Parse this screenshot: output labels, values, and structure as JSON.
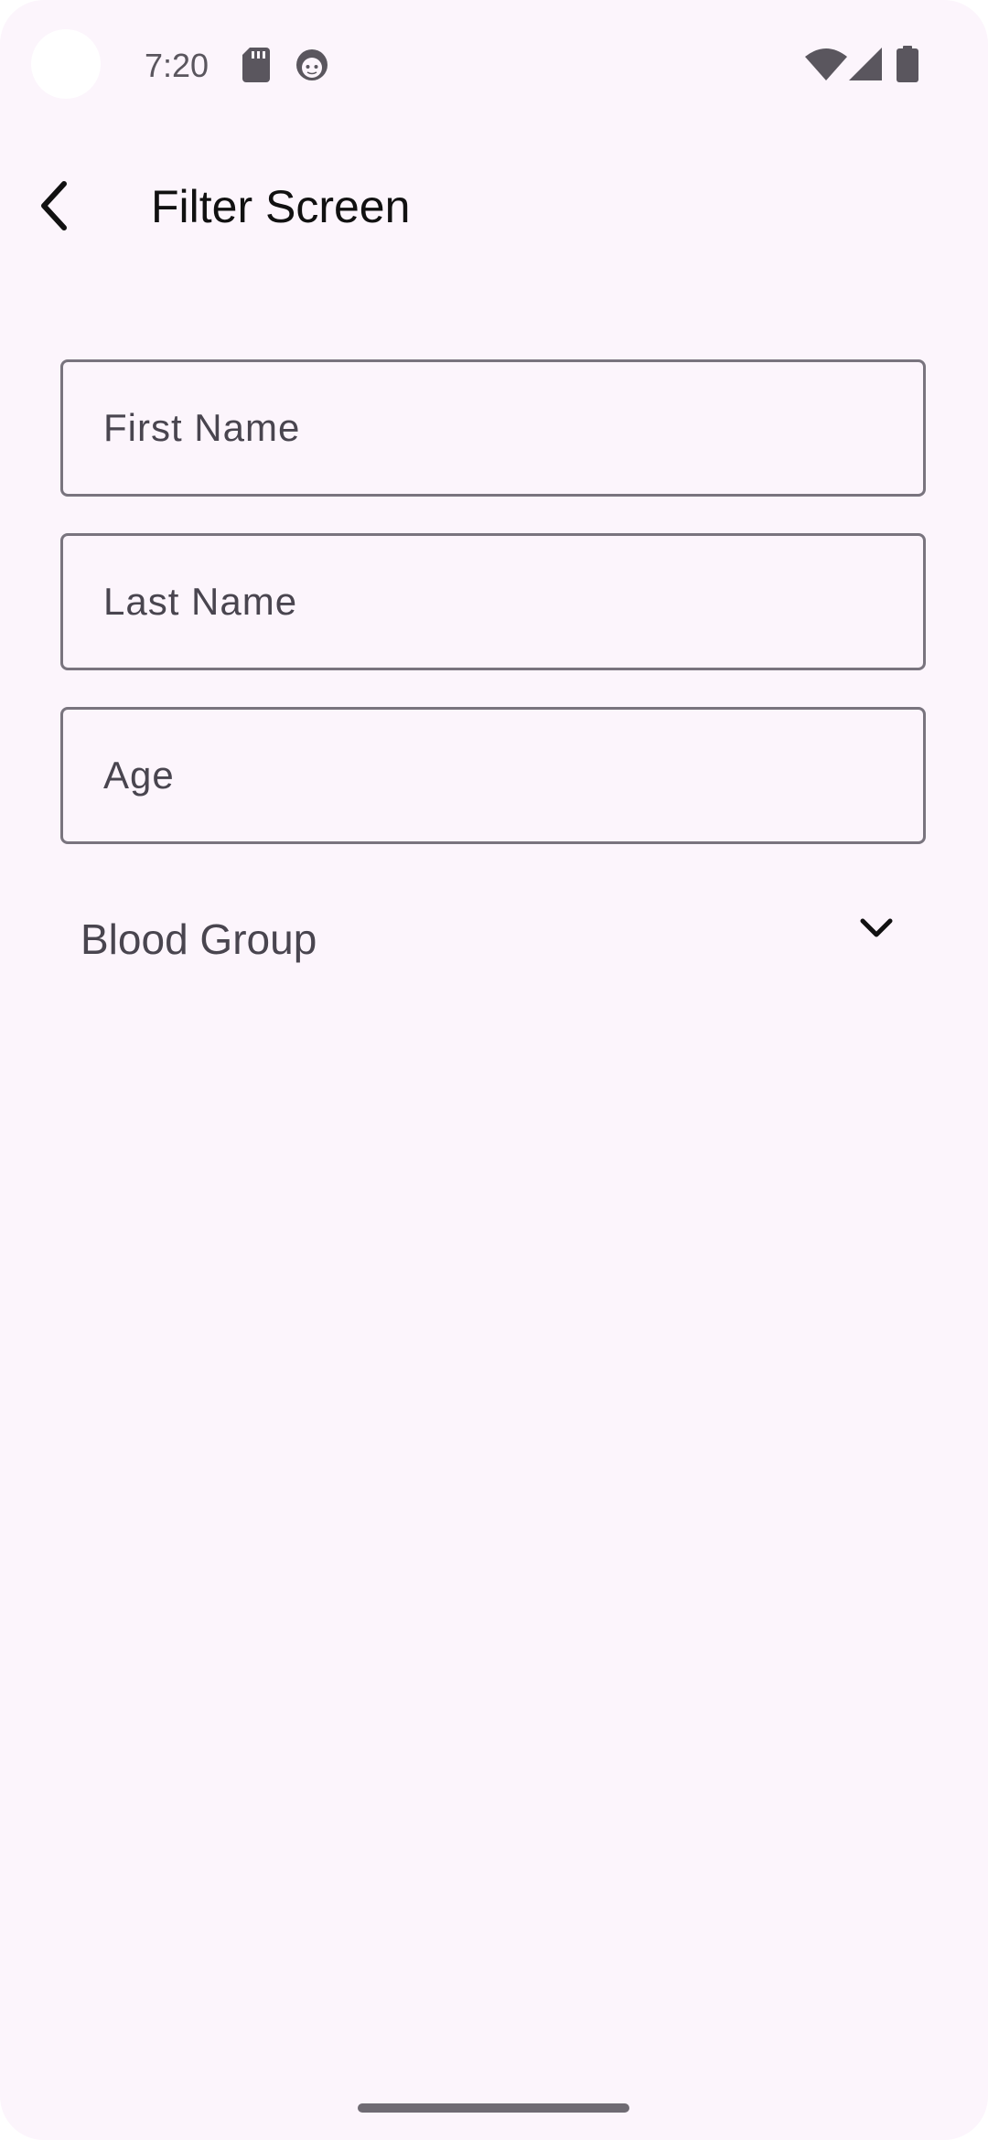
{
  "status_bar": {
    "time": "7:20",
    "icons": [
      "sd-card-icon",
      "face-icon",
      "wifi-icon",
      "signal-icon",
      "battery-icon"
    ]
  },
  "app_bar": {
    "back_icon": "arrow-back-icon",
    "title": "Filter Screen"
  },
  "form": {
    "first_name": {
      "placeholder": "First Name",
      "value": ""
    },
    "last_name": {
      "placeholder": "Last Name",
      "value": ""
    },
    "age": {
      "placeholder": "Age",
      "value": ""
    },
    "blood_group": {
      "label": "Blood Group",
      "icon": "chevron-down-icon"
    }
  },
  "colors": {
    "background": "#fcf5fc",
    "outline": "#79747e",
    "text_secondary": "#49454f",
    "text_primary": "#111111"
  }
}
